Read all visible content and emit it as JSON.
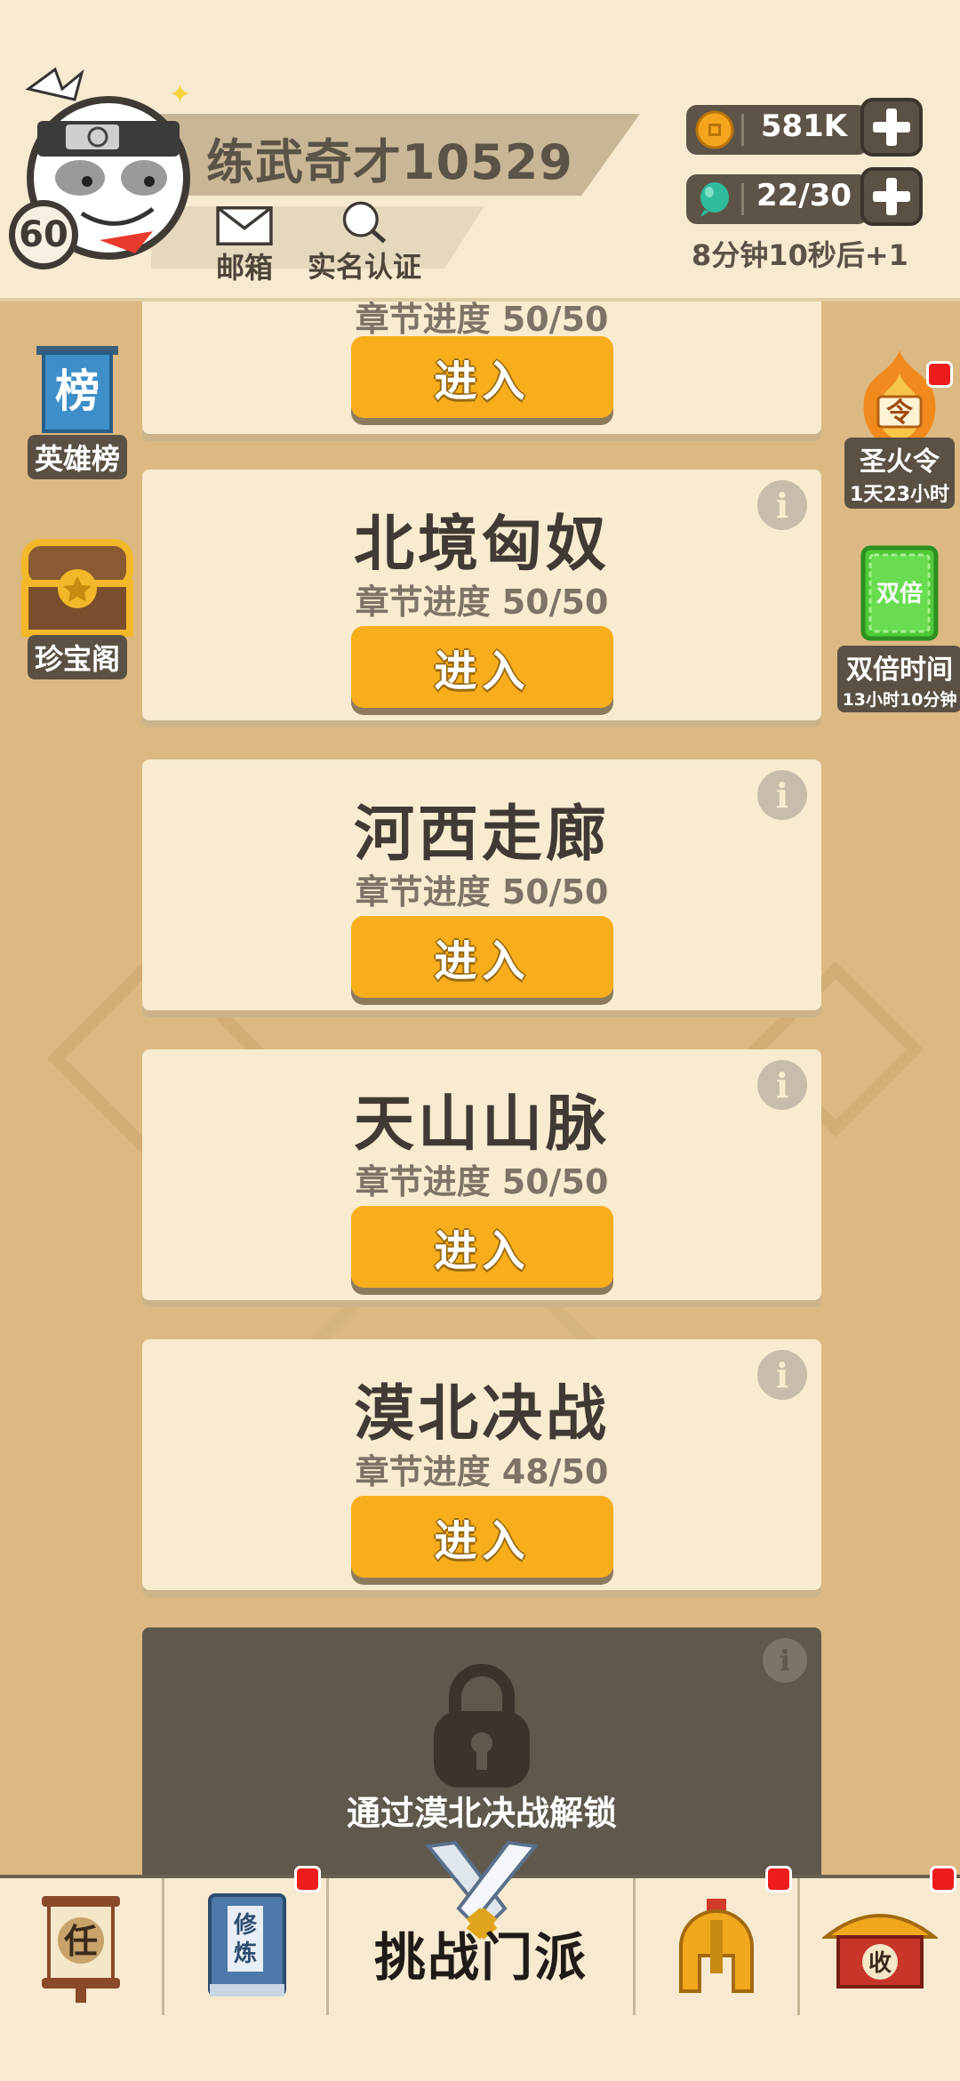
{
  "player": {
    "name": "练武奇才10529",
    "level": "60",
    "mail_label": "邮箱",
    "verify_label": "实名认证"
  },
  "resources": {
    "coins": "581K",
    "stamina": "22/30",
    "timer": "8分钟10秒后+1"
  },
  "side_left": [
    {
      "label": "英雄榜",
      "icon_char": "榜"
    },
    {
      "label": "珍宝阁"
    }
  ],
  "side_right": [
    {
      "label": "圣火令",
      "sub": "1天23小时",
      "icon_char": "令"
    },
    {
      "label": "双倍时间",
      "sub": "13小时10分钟",
      "icon_char": "双倍"
    }
  ],
  "stages": [
    {
      "title": "章节进度 50/50",
      "progress": "章节进度 50/50",
      "button": "进入"
    },
    {
      "title": "北境匈奴",
      "progress": "章节进度 50/50",
      "button": "进入"
    },
    {
      "title": "河西走廊",
      "progress": "章节进度 50/50",
      "button": "进入"
    },
    {
      "title": "天山山脉",
      "progress": "章节进度 50/50",
      "button": "进入"
    },
    {
      "title": "漠北决战",
      "progress": "章节进度 48/50",
      "button": "进入"
    }
  ],
  "locked": {
    "text": "通过漠北决战解锁"
  },
  "info_glyph": "i",
  "nav": {
    "task_char": "任",
    "cultivate_chars": "修炼",
    "challenge_label": "挑战门派",
    "collect_char": "收"
  },
  "colors": {
    "accent": "#f8ae1c",
    "card": "#f8ebcf",
    "background": "#dcb983",
    "badge_red": "#ee1c1c"
  }
}
